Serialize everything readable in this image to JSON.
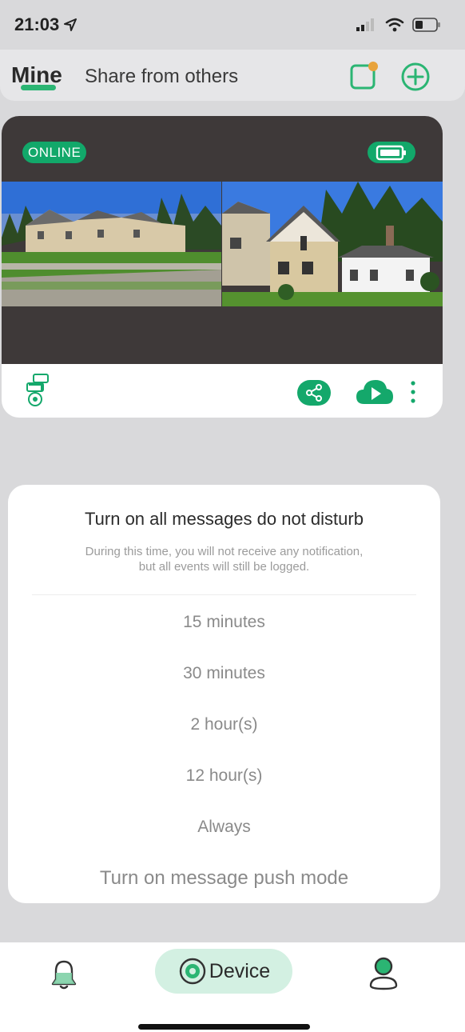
{
  "status_bar": {
    "time": "21:03"
  },
  "header": {
    "tabs": [
      {
        "label": "Mine",
        "active": true
      },
      {
        "label": "Share from others",
        "active": false
      }
    ]
  },
  "device_card": {
    "status_badge": "ONLINE",
    "icons": [
      "battery-icon",
      "camera-device-icon",
      "share-icon",
      "cloud-play-icon",
      "more-vertical-icon"
    ]
  },
  "dnd_dialog": {
    "title": "Turn on all messages do not disturb",
    "description_line1": "During this time, you will not receive any notification,",
    "description_line2": "but all events will still be logged.",
    "options": [
      "15 minutes",
      "30 minutes",
      "2 hour(s)",
      "12 hour(s)",
      "Always"
    ],
    "push_mode": "Turn on message push mode"
  },
  "bottom_nav": {
    "items": [
      {
        "icon": "bell-icon",
        "label": ""
      },
      {
        "icon": "device-icon",
        "label": "Device",
        "active": true
      },
      {
        "icon": "profile-icon",
        "label": ""
      }
    ]
  },
  "colors": {
    "accent": "#12a86a",
    "card_dark": "#3e3939",
    "nav_active_bg": "#d3f0e2"
  }
}
